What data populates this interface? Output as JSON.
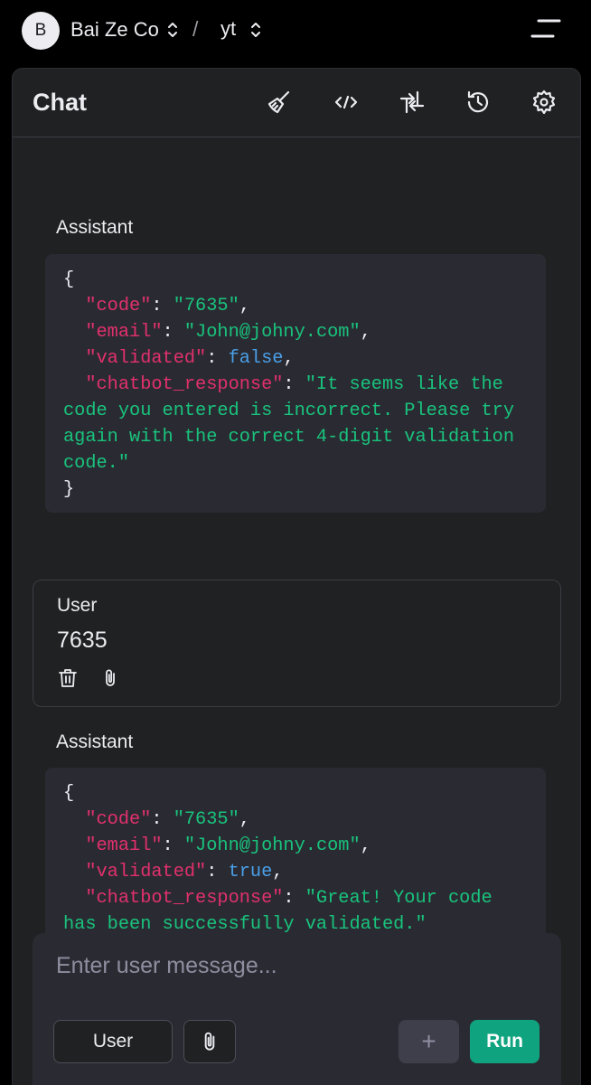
{
  "org": {
    "avatar_letter": "B",
    "name": "Bai Ze Co"
  },
  "breadcrumb_separator": "/",
  "project": {
    "name": "yt"
  },
  "panel": {
    "title": "Chat"
  },
  "header_icons": [
    "clear-broom-icon",
    "code-icon",
    "compare-arrows-icon",
    "history-icon",
    "settings-gear-icon"
  ],
  "messages": [
    {
      "role": "Assistant",
      "json": {
        "open": "{",
        "close": "}",
        "code_key": "\"code\"",
        "code_val": "\"7635\"",
        "email_key": "\"email\"",
        "email_val": "\"John@johny.com\"",
        "validated_key": "\"validated\"",
        "validated_val": "false",
        "response_key": "\"chatbot_response\"",
        "response_val": "\"It seems like the code you entered is incorrect. Please try again with the correct 4-digit validation code.\""
      }
    },
    {
      "role": "User",
      "text": "7635"
    },
    {
      "role": "Assistant",
      "json": {
        "open": "{",
        "code_key": "\"code\"",
        "code_val": "\"7635\"",
        "email_key": "\"email\"",
        "email_val": "\"John@johny.com\"",
        "validated_key": "\"validated\"",
        "validated_val": "true",
        "response_key": "\"chatbot_response\"",
        "response_val": "\"Great! Your code has been successfully validated.\""
      }
    }
  ],
  "composer": {
    "placeholder": "Enter user message...",
    "role_button": "User",
    "add_button": "+",
    "run_button": "Run"
  },
  "colors": {
    "background": "#000000",
    "panel": "#202123",
    "code_bg": "#2a2b32",
    "json_key": "#e1306c",
    "json_string": "#19c37d",
    "json_bool": "#4a9fe8",
    "run_button": "#10a37f"
  }
}
